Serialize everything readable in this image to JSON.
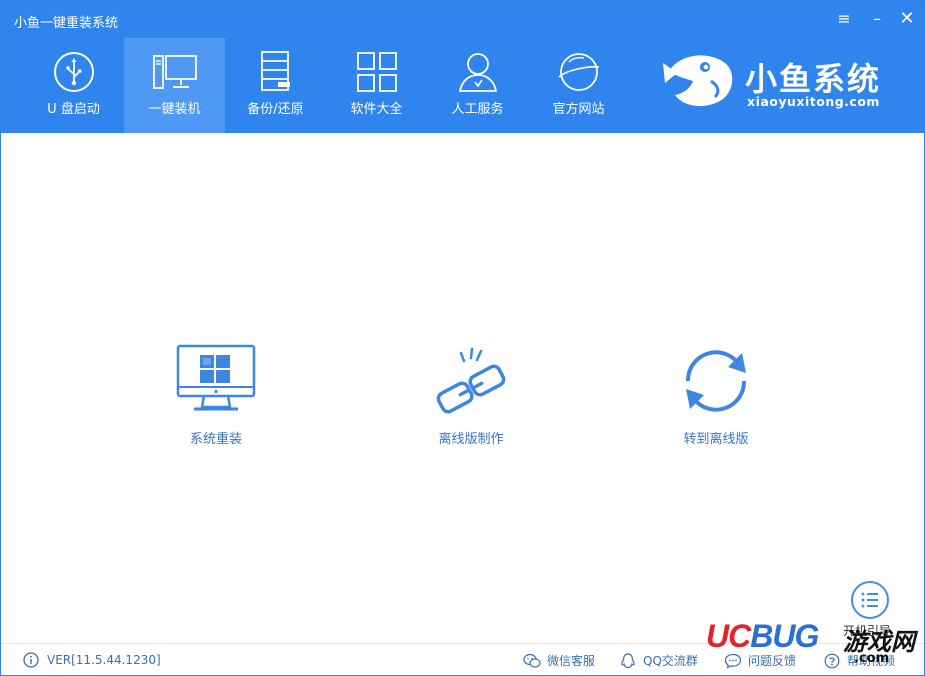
{
  "app": {
    "title": "小鱼一键重装系统",
    "brand_color": "#2f84ee",
    "active_tab_color": "#4f98f3"
  },
  "window_controls": {
    "menu_glyph": "≡",
    "minimize_glyph": "–",
    "close_glyph": "✕"
  },
  "nav": {
    "items": [
      {
        "label": "U 盘启动",
        "icon": "usb-icon",
        "active": false
      },
      {
        "label": "一键装机",
        "icon": "computer-icon",
        "active": true
      },
      {
        "label": "备份/还原",
        "icon": "backup-icon",
        "active": false
      },
      {
        "label": "软件大全",
        "icon": "apps-grid-icon",
        "active": false
      },
      {
        "label": "人工服务",
        "icon": "support-person-icon",
        "active": false
      },
      {
        "label": "官方网站",
        "icon": "globe-icon",
        "active": false
      }
    ]
  },
  "logo": {
    "name": "小鱼系统",
    "domain": "xiaoyuxitong.com"
  },
  "actions": [
    {
      "label": "系统重装",
      "icon": "monitor-windows-icon"
    },
    {
      "label": "离线版制作",
      "icon": "chain-link-icon"
    },
    {
      "label": "转到离线版",
      "icon": "refresh-cycle-icon"
    }
  ],
  "fab": {
    "label": "开机引导",
    "icon": "list-menu-icon"
  },
  "footer": {
    "version": "VER[11.5.44.1230]",
    "links": [
      {
        "label": "微信客服",
        "icon": "wechat-icon"
      },
      {
        "label": "QQ交流群",
        "icon": "qq-icon"
      },
      {
        "label": "问题反馈",
        "icon": "feedback-icon"
      },
      {
        "label": "帮助视频",
        "icon": "help-icon"
      }
    ]
  },
  "watermark": {
    "uc": "UC",
    "bug": "BUG",
    "cn": "游戏网",
    "com": ".com"
  }
}
